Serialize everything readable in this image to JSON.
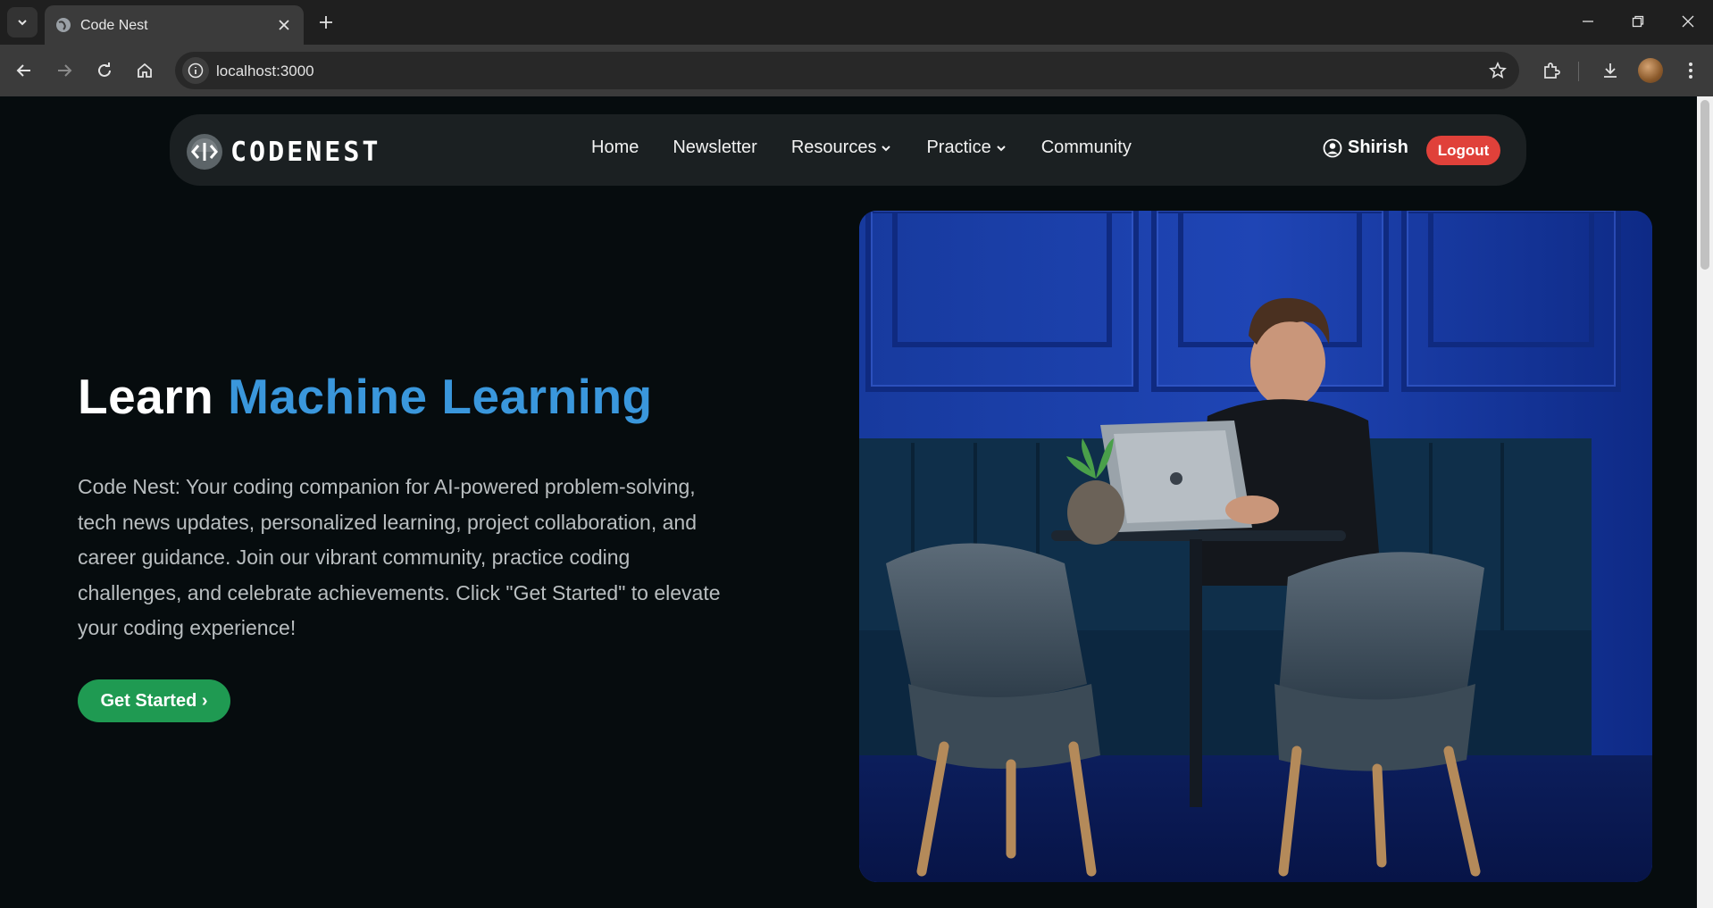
{
  "browser": {
    "tab_title": "Code Nest",
    "url": "localhost:3000",
    "icons": [
      "tab-search-icon",
      "globe-icon",
      "close-icon",
      "plus-icon",
      "minimize-icon",
      "restore-icon",
      "window-close-icon",
      "back-icon",
      "forward-icon",
      "reload-icon",
      "home-icon",
      "info-icon",
      "star-icon",
      "extensions-icon",
      "download-icon",
      "more-icon"
    ]
  },
  "site": {
    "logo_text": "CODENEST",
    "nav": {
      "home": "Home",
      "newsletter": "Newsletter",
      "resources": "Resources",
      "practice": "Practice",
      "community": "Community"
    },
    "user_name": "Shirish",
    "logout_label": "Logout"
  },
  "hero": {
    "title_prefix": "Learn",
    "title_accent": "Machine Learning",
    "description": "Code Nest: Your coding companion for AI-powered problem-solving, tech news updates, personalized learning, project collaboration, and career guidance. Join our vibrant community, practice coding challenges, and celebrate achievements. Click \"Get Started\" to elevate your coding experience!",
    "cta_label": "Get Started ›"
  },
  "colors": {
    "accent": "#3a97dc",
    "cta": "#1f9a52",
    "logout": "#e0413a",
    "background": "#060c0e"
  }
}
